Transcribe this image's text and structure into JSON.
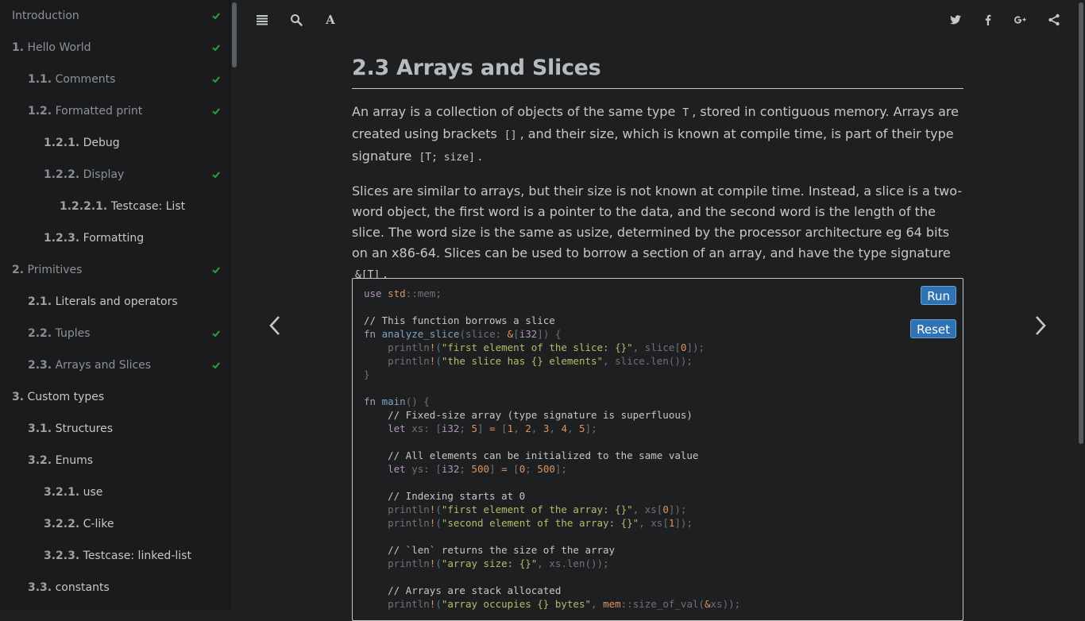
{
  "sidebar": {
    "items": [
      {
        "num": "",
        "label": "Introduction",
        "done": true,
        "level": 0
      },
      {
        "num": "1.",
        "label": "Hello World",
        "done": true,
        "level": 0
      },
      {
        "num": "1.1.",
        "label": "Comments",
        "done": true,
        "level": 1
      },
      {
        "num": "1.2.",
        "label": "Formatted print",
        "done": true,
        "level": 1
      },
      {
        "num": "1.2.1.",
        "label": "Debug",
        "done": false,
        "level": 2
      },
      {
        "num": "1.2.2.",
        "label": "Display",
        "done": true,
        "level": 2
      },
      {
        "num": "1.2.2.1.",
        "label": "Testcase: List",
        "done": false,
        "level": 3
      },
      {
        "num": "1.2.3.",
        "label": "Formatting",
        "done": false,
        "level": 2
      },
      {
        "num": "2.",
        "label": "Primitives",
        "done": true,
        "level": 0
      },
      {
        "num": "2.1.",
        "label": "Literals and operators",
        "done": false,
        "level": 1
      },
      {
        "num": "2.2.",
        "label": "Tuples",
        "done": true,
        "level": 1
      },
      {
        "num": "2.3.",
        "label": "Arrays and Slices",
        "done": true,
        "level": 1
      },
      {
        "num": "3.",
        "label": "Custom types",
        "done": false,
        "level": 0
      },
      {
        "num": "3.1.",
        "label": "Structures",
        "done": false,
        "level": 1
      },
      {
        "num": "3.2.",
        "label": "Enums",
        "done": false,
        "level": 1
      },
      {
        "num": "3.2.1.",
        "label": "use",
        "done": false,
        "level": 2
      },
      {
        "num": "3.2.2.",
        "label": "C-like",
        "done": false,
        "level": 2
      },
      {
        "num": "3.2.3.",
        "label": "Testcase: linked-list",
        "done": false,
        "level": 2
      },
      {
        "num": "3.3.",
        "label": "constants",
        "done": false,
        "level": 1
      }
    ]
  },
  "toolbar": {
    "left_icons": [
      "menu-icon",
      "search-icon",
      "font-settings-icon"
    ],
    "font_glyph": "A",
    "right_icons": [
      "twitter-icon",
      "facebook-icon",
      "google-plus-icon",
      "share-icon"
    ]
  },
  "page": {
    "title": "2.3 Arrays and Slices",
    "p1_a": "An array is a collection of objects of the same type ",
    "p1_code1": "T",
    "p1_b": ", stored in contiguous memory. Arrays are created using brackets ",
    "p1_code2": "[]",
    "p1_c": ", and their size, which is known at compile time, is part of their type signature ",
    "p1_code3": "[T; size]",
    "p1_d": ".",
    "p2_a": "Slices are similar to arrays, but their size is not known at compile time. Instead, a slice is a two-word object, the first word is a pointer to the data, and the second word is the length of the slice. The word size is the same as usize, determined by the processor architecture eg 64 bits on an x86-64. Slices can be used to borrow a section of an array, and have the type signature ",
    "p2_code": "&[T]",
    "p2_b": "."
  },
  "code": {
    "run_label": "Run",
    "reset_label": "Reset"
  },
  "colors": {
    "background": "#1d1f21",
    "sidebar_bg": "#191b1d",
    "check_green": "#2ea043",
    "button_blue": "#2f73b5",
    "keyword": "#b294bb",
    "string": "#b5bd68",
    "number": "#de935f",
    "function": "#81a2be"
  }
}
